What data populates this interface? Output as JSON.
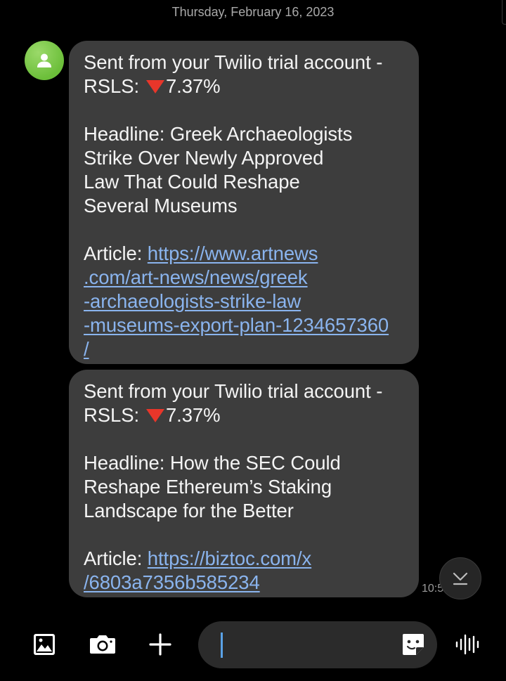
{
  "conversation": {
    "date_header": "Thursday, February 16, 2023",
    "contact_avatar": "person-icon",
    "messages": [
      {
        "sender_line": "Sent from your Twilio trial account -",
        "ticker_prefix": "RSLS:",
        "change_icon": "red-down-triangle",
        "change_value": "7.37%",
        "headline_lines": [
          "Headline: Greek Archaeologists",
          "Strike Over Newly Approved",
          "Law That Could Reshape",
          "Several Museums"
        ],
        "article_label": "Article: ",
        "link_lines": [
          "https://www.artnews",
          ".com/art-news/news/greek",
          "-archaeologists-strike-law",
          "-museums-export-plan-1234657360",
          "/"
        ]
      },
      {
        "sender_line": "Sent from your Twilio trial account -",
        "ticker_prefix": "RSLS:",
        "change_icon": "red-down-triangle",
        "change_value": "7.37%",
        "headline_lines": [
          "Headline: How the SEC Could",
          "Reshape Ethereum’s Staking",
          "Landscape for the Better"
        ],
        "article_label": "Article: ",
        "link_lines": [
          "https://biztoc.com/x",
          "/6803a7356b585234"
        ],
        "timestamp": "10:5"
      }
    ]
  },
  "composer": {
    "gallery_icon": "gallery-icon",
    "camera_icon": "camera-icon",
    "plus_icon": "plus-icon",
    "input_value": "",
    "sticker_icon": "sticker-icon",
    "voice_icon": "voice-wave-icon"
  },
  "scroll_down_icon": "chevron-down-icon",
  "colors": {
    "background": "#000000",
    "bubble": "#3d3d3d",
    "link": "#8ab4ee",
    "caret": "#5aa2e6",
    "down_triangle": "#e8362a",
    "avatar": "#7cc94a"
  }
}
